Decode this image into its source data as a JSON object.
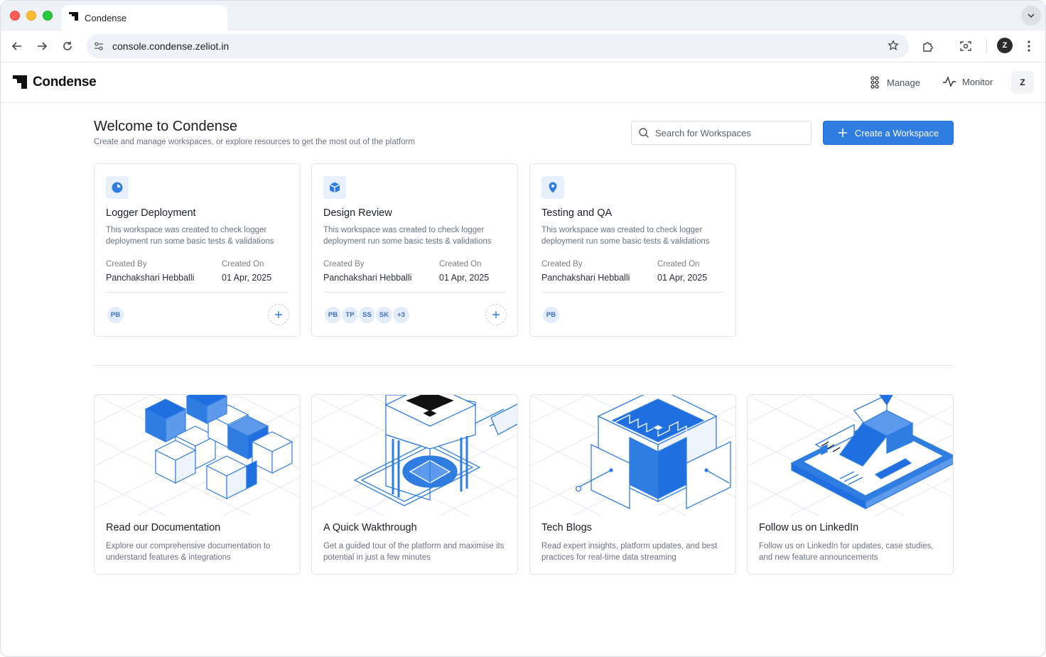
{
  "browser": {
    "tab_title": "Condense",
    "url": "console.condense.zeliot.in",
    "profile_initial": "Z"
  },
  "header": {
    "brand": "Condense",
    "nav": [
      {
        "label": "Manage",
        "icon": "manage-icon"
      },
      {
        "label": "Monitor",
        "icon": "activity-icon"
      }
    ],
    "user_initial": "Z"
  },
  "welcome": {
    "title": "Welcome to Condense",
    "subtitle": "Create and manage workspaces, or explore resources to get the most out of the platform"
  },
  "search": {
    "placeholder": "Search for Workspaces"
  },
  "create_button": {
    "label": "Create a Workspace"
  },
  "meta_labels": {
    "created_by": "Created By",
    "created_on": "Created On"
  },
  "workspaces": [
    {
      "title": "Logger Deployment",
      "icon": "chart-pie-icon",
      "description": "This workspace was created to check logger deployment run some basic tests & validations",
      "created_by": "Panchakshari Hebballi",
      "created_on": "01 Apr, 2025",
      "members": [
        "PB"
      ]
    },
    {
      "title": "Design Review",
      "icon": "cube-icon",
      "description": "This workspace was created to check logger deployment run some basic tests & validations",
      "created_by": "Panchakshari Hebballi",
      "created_on": "01 Apr, 2025",
      "members": [
        "PB",
        "TP",
        "SS",
        "SK",
        "+3"
      ]
    },
    {
      "title": "Testing and QA",
      "icon": "location-pin-icon",
      "description": "This workspace was created to check logger deployment run some basic tests & validations",
      "created_by": "Panchakshari Hebballi",
      "created_on": "01 Apr, 2025",
      "members": [
        "PB"
      ]
    }
  ],
  "resources": [
    {
      "title": "Read our Documentation",
      "description": "Explore our comprehensive documentation to understand features & integrations"
    },
    {
      "title": "A Quick Wakthrough",
      "description": "Get a guided tour of the platform and maximise its potential in just a few minutes"
    },
    {
      "title": "Tech Blogs",
      "description": "Read expert insights, platform updates, and best practices for real-time data streaming"
    },
    {
      "title": "Follow us on LinkedIn",
      "description": "Follow us on LinkedIn for updates, case studies, and new feature announcements"
    }
  ],
  "colors": {
    "accent": "#2f7de1",
    "accent_light": "#e8f0fc",
    "text_muted": "#6b7280",
    "border": "#e1e4e8"
  }
}
